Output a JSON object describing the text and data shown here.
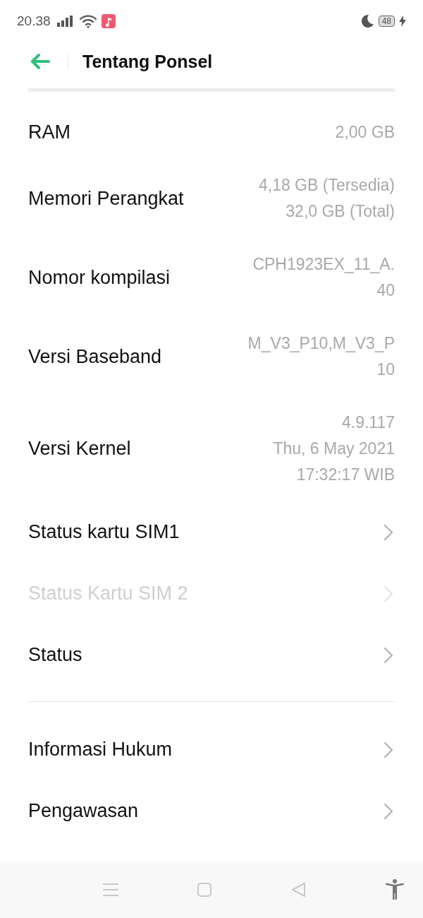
{
  "status_bar": {
    "time": "20.38",
    "battery": "48"
  },
  "header": {
    "title": "Tentang Ponsel"
  },
  "info_rows": [
    {
      "label": "RAM",
      "value_lines": [
        "2,00 GB"
      ]
    },
    {
      "label": "Memori Perangkat",
      "value_lines": [
        "4,18 GB (Tersedia)",
        "32,0 GB (Total)"
      ]
    },
    {
      "label": "Nomor kompilasi",
      "value_lines": [
        "CPH1923EX_11_A.",
        "40"
      ]
    },
    {
      "label": "Versi Baseband",
      "value_lines": [
        "M_V3_P10,M_V3_P",
        "10"
      ]
    },
    {
      "label": "Versi Kernel",
      "value_lines": [
        "4.9.117",
        "Thu, 6 May 2021",
        "17:32:17 WIB"
      ]
    }
  ],
  "nav_rows": [
    {
      "label": "Status kartu SIM1",
      "disabled": false
    },
    {
      "label": "Status Kartu SIM 2",
      "disabled": true
    },
    {
      "label": "Status",
      "disabled": false
    }
  ],
  "legal_rows": [
    {
      "label": "Informasi Hukum",
      "disabled": false
    },
    {
      "label": "Pengawasan",
      "disabled": false
    }
  ]
}
